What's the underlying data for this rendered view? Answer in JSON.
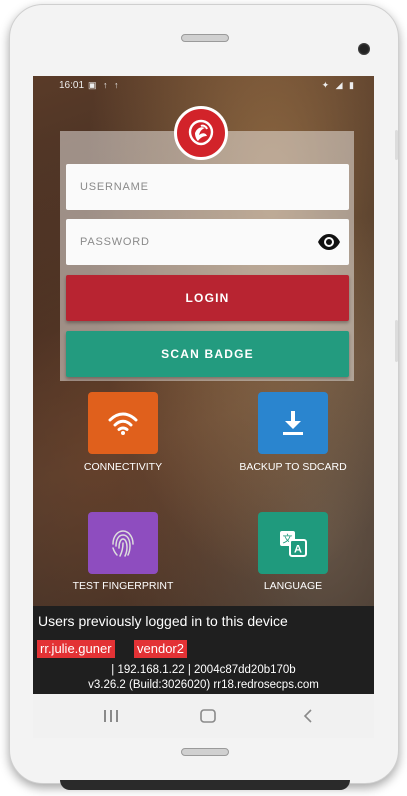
{
  "status_bar": {
    "time": "16:01",
    "left_icons": "▣ ↑ ↑",
    "right_icons": "✦ ◢ ▮"
  },
  "login": {
    "username_placeholder": "USERNAME",
    "password_placeholder": "PASSWORD",
    "login_label": "LOGIN",
    "scan_badge_label": "SCAN BADGE"
  },
  "tiles": [
    {
      "label": "CONNECTIVITY",
      "color": "#e0601c",
      "icon": "wifi-icon"
    },
    {
      "label": "BACKUP TO SDCARD",
      "color": "#2a85cf",
      "icon": "download-icon"
    },
    {
      "label": "TEST FINGERPRINT",
      "color": "#8e4dbf",
      "icon": "fingerprint-icon"
    },
    {
      "label": "LANGUAGE",
      "color": "#1f9a7d",
      "icon": "translate-icon"
    }
  ],
  "previous_users": {
    "title": "Users previously logged in to this device",
    "users": [
      "rr.julie.guner",
      "vendor2"
    ],
    "device_info": "| 192.168.1.22 | 2004c87dd20b170b",
    "version_info": "v3.26.2 (Build:3026020) rr18.redrosecps.com"
  },
  "colors": {
    "brand_red": "#d2232a",
    "login_button": "#b82431",
    "scan_button": "#239b7f",
    "user_chip": "#e33235"
  }
}
